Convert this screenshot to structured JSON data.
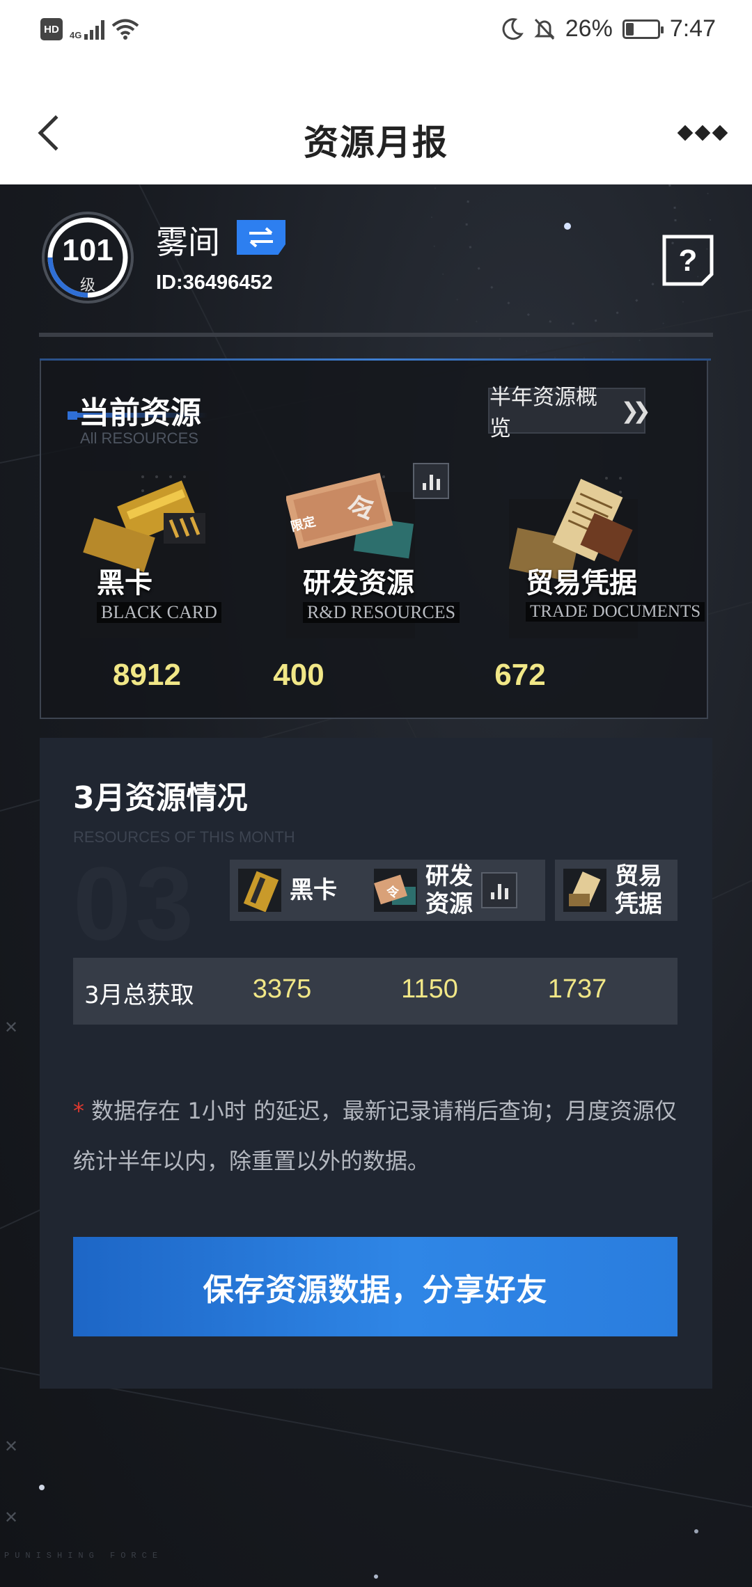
{
  "status_bar": {
    "hd": "HD",
    "network": "4G",
    "battery": "26%",
    "battery_level": 0.26,
    "time": "7:47",
    "icons": [
      "hd-icon",
      "signal-icon",
      "wifi-icon",
      "moon-icon",
      "bell-off-icon",
      "battery-icon"
    ]
  },
  "nav": {
    "title": "资源月报",
    "back_icon": "chevron-left-icon",
    "more_icon": "more-icon"
  },
  "profile": {
    "level": "101",
    "level_unit": "级",
    "level_progress": 0.25,
    "username": "雾间",
    "user_id": "ID:36496452",
    "swap_icon": "swap-icon",
    "help_icon": "help-icon"
  },
  "current_resources": {
    "title": "当前资源",
    "subtitle": "All RESOURCES",
    "overview_button": "半年资源概览",
    "items": [
      {
        "name": "黑卡",
        "name_en": "BLACK CARD",
        "value": "8912"
      },
      {
        "name": "研发资源",
        "name_en": "R&D RESOURCES",
        "value": "400",
        "badge": "限定"
      },
      {
        "name": "贸易凭据",
        "name_en": "TRADE DOCUMENTS",
        "value": "672"
      }
    ]
  },
  "monthly": {
    "title": "3月资源情况",
    "subtitle": "RESOURCES OF THIS MONTH",
    "month_number": "03",
    "tags": [
      {
        "label_line1": "黑卡",
        "label_line2": ""
      },
      {
        "label_line1": "研发",
        "label_line2": "资源"
      },
      {
        "label_line1": "贸易",
        "label_line2": "凭据"
      }
    ],
    "total_label": "3月总获取",
    "totals": [
      "3375",
      "1150",
      "1737"
    ],
    "note_star": "*",
    "note_text": " 数据存在 1小时 的延迟，最新记录请稍后查询；月度资源仅统计半年以内，除重置以外的数据。",
    "share_button": "保存资源数据，分享好友"
  },
  "footer": {
    "brand": "PUNISHING FORCE"
  },
  "colors": {
    "accent_blue": "#2f6fd6",
    "value_yellow": "#f1e787",
    "panel_dark": "#202631"
  }
}
